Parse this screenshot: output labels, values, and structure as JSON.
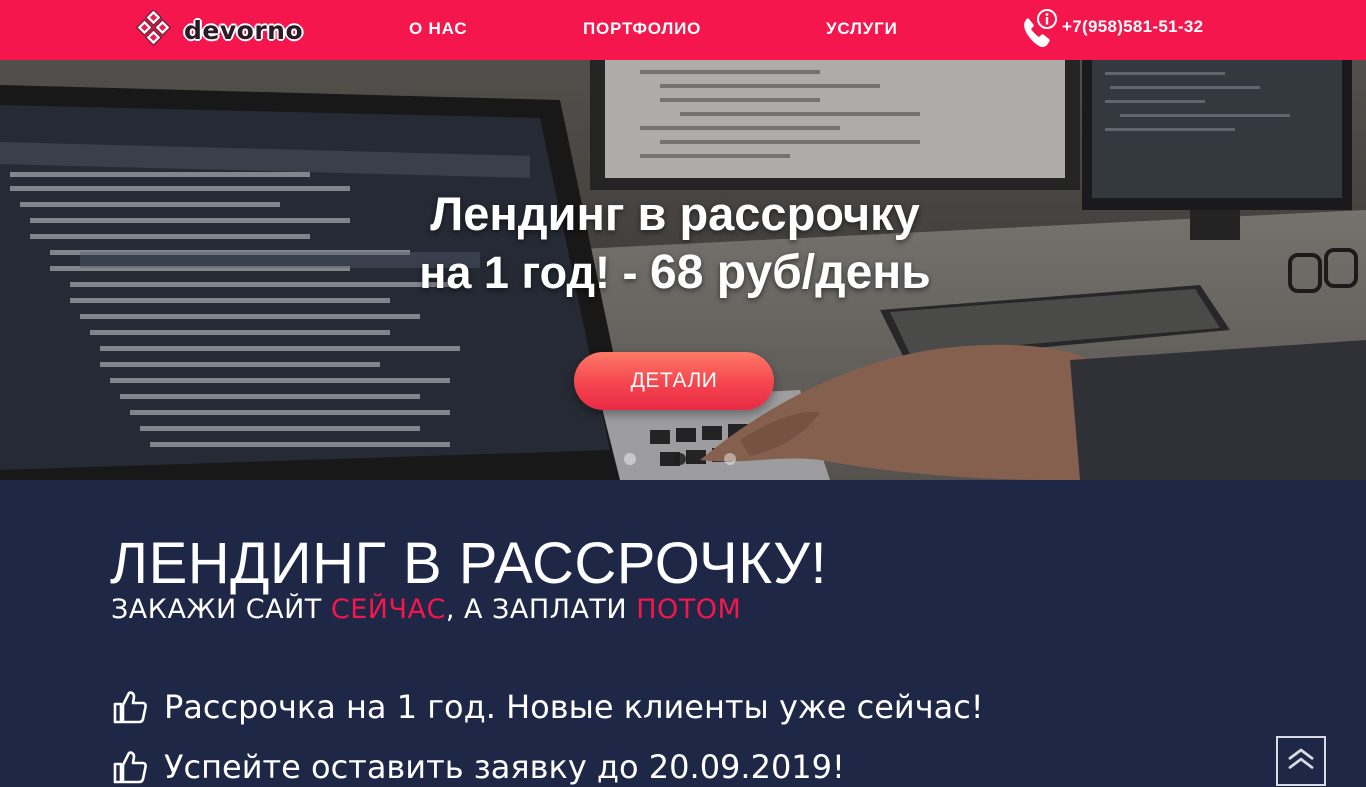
{
  "header": {
    "logo_text": "devorno",
    "nav": [
      {
        "label": "О НАС"
      },
      {
        "label": "ПОРТФОЛИО"
      },
      {
        "label": "УСЛУГИ"
      }
    ],
    "phone": "+7(958)581-51-32",
    "colors": {
      "header_bg": "#f4164d",
      "accent": "#f4164d"
    }
  },
  "hero": {
    "title_line1": "Лендинг в рассрочку",
    "title_line2_pre": "на 1 год! - ",
    "title_line2_emph": "68 руб/день",
    "button_label": "ДЕТАЛИ",
    "slides": {
      "count": 3,
      "active_index": 1
    }
  },
  "content": {
    "title": "ЛЕНДИНГ В РАССРОЧКУ!",
    "subtitle": {
      "part1": "ЗАКАЖИ САЙТ ",
      "accent1": "СЕЙЧАС",
      "part2": ", А ЗАПЛАТИ ",
      "accent2": "ПОТОМ"
    },
    "features": [
      {
        "icon": "thumbs-up-icon",
        "text": "Рассрочка на 1 год. Новые клиенты уже сейчас!"
      },
      {
        "icon": "thumbs-up-icon",
        "text": "Успейте оставить заявку до 20.09.2019!"
      }
    ],
    "colors": {
      "bg": "#1e2746"
    }
  },
  "scroll_top": {
    "icon": "chevrons-up-icon"
  }
}
